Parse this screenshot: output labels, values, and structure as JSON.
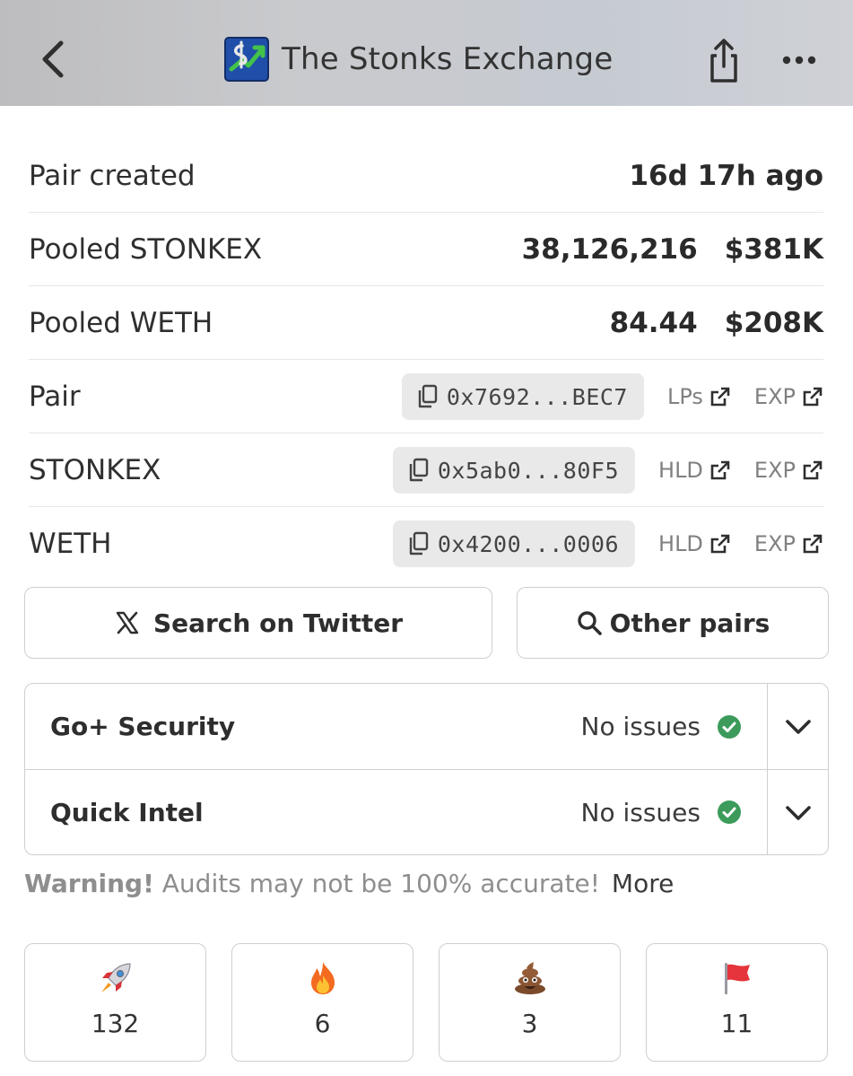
{
  "header": {
    "title": "The Stonks Exchange",
    "icons": {
      "back": "chevron-left-icon",
      "share": "share-icon",
      "more": "more-horizontal-icon",
      "logo": "stonks-exchange-logo"
    }
  },
  "info": {
    "pair_created": {
      "label": "Pair created",
      "value": "16d 17h ago"
    },
    "pooled_token": {
      "label": "Pooled STONKEX",
      "amount": "38,126,216",
      "usd": "$381K"
    },
    "pooled_weth": {
      "label": "Pooled WETH",
      "amount": "84.44",
      "usd": "$208K"
    },
    "addresses": [
      {
        "label": "Pair",
        "address": "0x7692...BEC7",
        "link1": "LPs",
        "link2": "EXP"
      },
      {
        "label": "STONKEX",
        "address": "0x5ab0...80F5",
        "link1": "HLD",
        "link2": "EXP"
      },
      {
        "label": "WETH",
        "address": "0x4200...0006",
        "link1": "HLD",
        "link2": "EXP"
      }
    ]
  },
  "actions": {
    "twitter_label": "Search on Twitter",
    "pairs_label": "Other pairs"
  },
  "audits": [
    {
      "name": "Go+ Security",
      "status": "No issues"
    },
    {
      "name": "Quick Intel",
      "status": "No issues"
    }
  ],
  "warning": {
    "prefix": "Warning!",
    "text": "Audits may not be 100% accurate!",
    "more": "More"
  },
  "reactions": [
    {
      "icon": "rocket-icon",
      "count": "132"
    },
    {
      "icon": "fire-icon",
      "count": "6"
    },
    {
      "icon": "poop-icon",
      "count": "3"
    },
    {
      "icon": "red-flag-icon",
      "count": "11"
    }
  ],
  "colors": {
    "status_ok": "#3c9b5a",
    "header_bg": "#c6c8cc",
    "pill_bg": "#e9e9e9"
  }
}
